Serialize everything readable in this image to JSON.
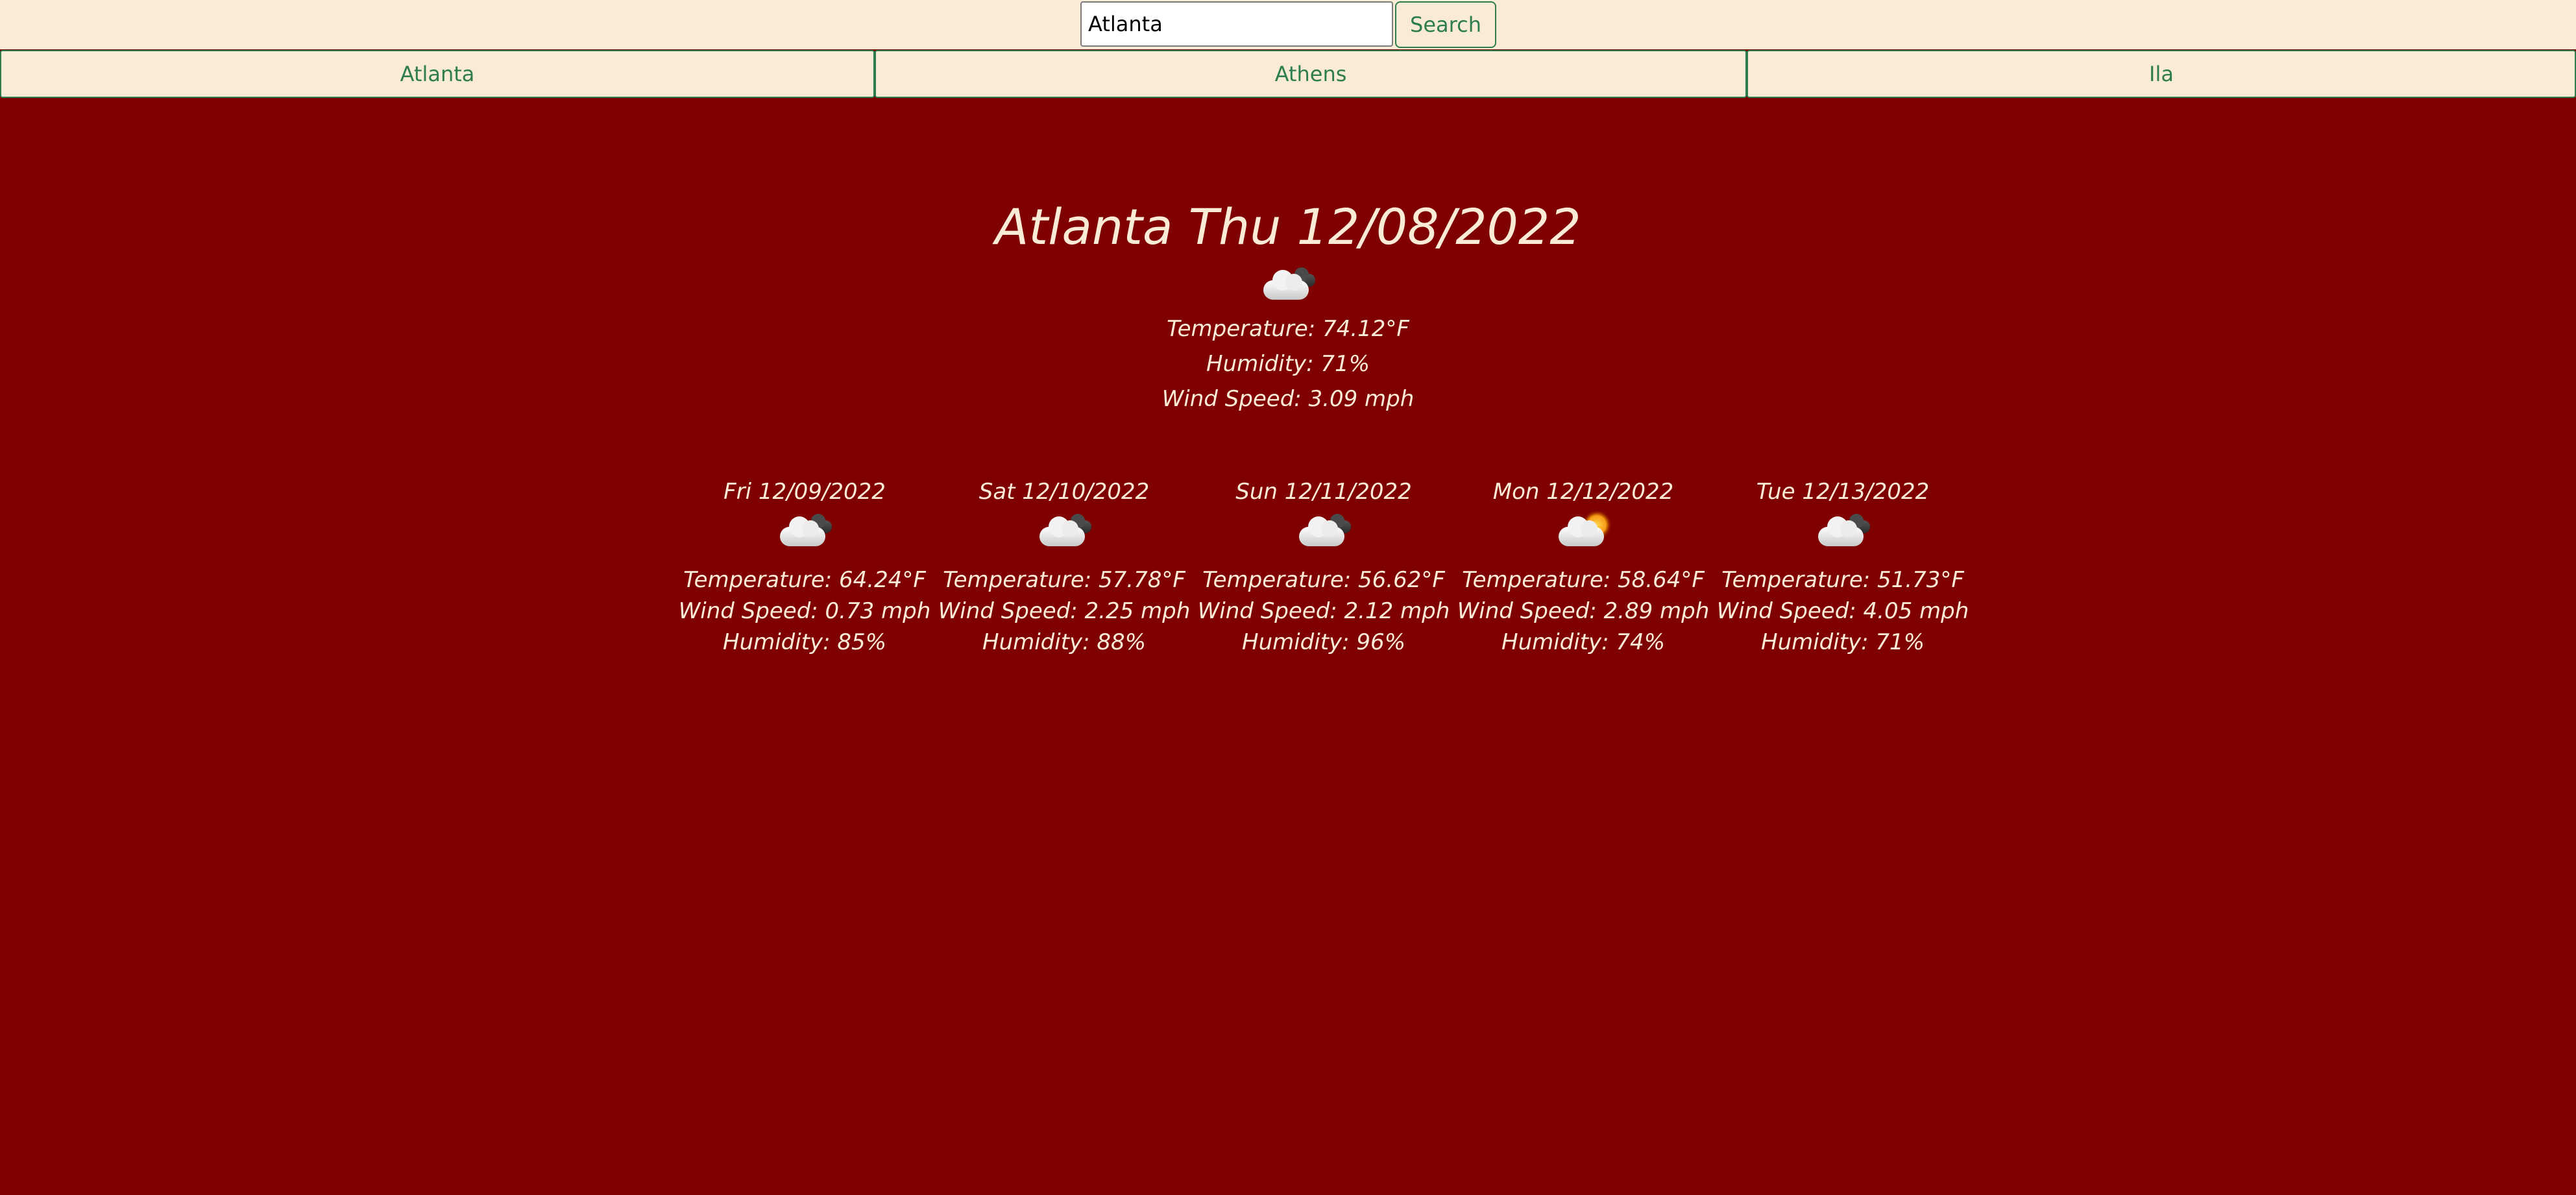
{
  "search": {
    "value": "Atlanta",
    "button_label": "Search"
  },
  "saved_cities": [
    "Atlanta",
    "Athens",
    "Ila"
  ],
  "current": {
    "title": "Atlanta Thu 12/08/2022",
    "icon": "broken-clouds-icon",
    "temperature": "Temperature: 74.12°F",
    "humidity": "Humidity: 71%",
    "wind": "Wind Speed: 3.09 mph"
  },
  "forecast": [
    {
      "date": "Fri 12/09/2022",
      "icon": "broken-clouds-icon",
      "temperature": "Temperature: 64.24°F",
      "wind": "Wind Speed: 0.73 mph",
      "humidity": "Humidity: 85%"
    },
    {
      "date": "Sat 12/10/2022",
      "icon": "broken-clouds-icon",
      "temperature": "Temperature: 57.78°F",
      "wind": "Wind Speed: 2.25 mph",
      "humidity": "Humidity: 88%"
    },
    {
      "date": "Sun 12/11/2022",
      "icon": "broken-clouds-icon",
      "temperature": "Temperature: 56.62°F",
      "wind": "Wind Speed: 2.12 mph",
      "humidity": "Humidity: 96%"
    },
    {
      "date": "Mon 12/12/2022",
      "icon": "few-clouds-icon",
      "temperature": "Temperature: 58.64°F",
      "wind": "Wind Speed: 2.89 mph",
      "humidity": "Humidity: 74%"
    },
    {
      "date": "Tue 12/13/2022",
      "icon": "broken-clouds-icon",
      "temperature": "Temperature: 51.73°F",
      "wind": "Wind Speed: 4.05 mph",
      "humidity": "Humidity: 71%"
    }
  ],
  "colors": {
    "background": "#7f0000",
    "panel": "#faebd7",
    "accent": "#2e7d4f",
    "text": "#faebd7"
  }
}
